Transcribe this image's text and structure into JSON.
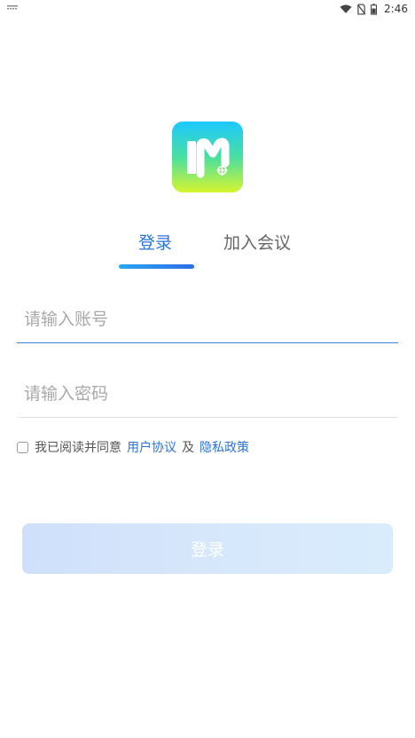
{
  "status_bar": {
    "time": "2:46",
    "left_icon": "notification-icon",
    "right_icons": [
      "wifi-icon",
      "no-sim-icon",
      "battery-icon"
    ]
  },
  "logo": {
    "icon": "meeting-app-logo-icon",
    "gradient": [
      "#1dc8ff",
      "#49dfa1",
      "#d6f52e"
    ]
  },
  "tabs": [
    {
      "label": "登录",
      "active": true
    },
    {
      "label": "加入会议",
      "active": false
    }
  ],
  "form": {
    "account_placeholder": "请输入账号",
    "account_value": "",
    "password_placeholder": "请输入密码",
    "password_value": ""
  },
  "agreement": {
    "checked": false,
    "text": "我已阅读并同意",
    "user_agreement": "用户协议",
    "and": "及",
    "privacy_policy": "隐私政策"
  },
  "login_button": {
    "label": "登录"
  },
  "colors": {
    "accent": "#2b73d9",
    "tab_inactive": "#666666",
    "placeholder": "#a9a9a9",
    "button_bg": "#d6e7fb"
  }
}
